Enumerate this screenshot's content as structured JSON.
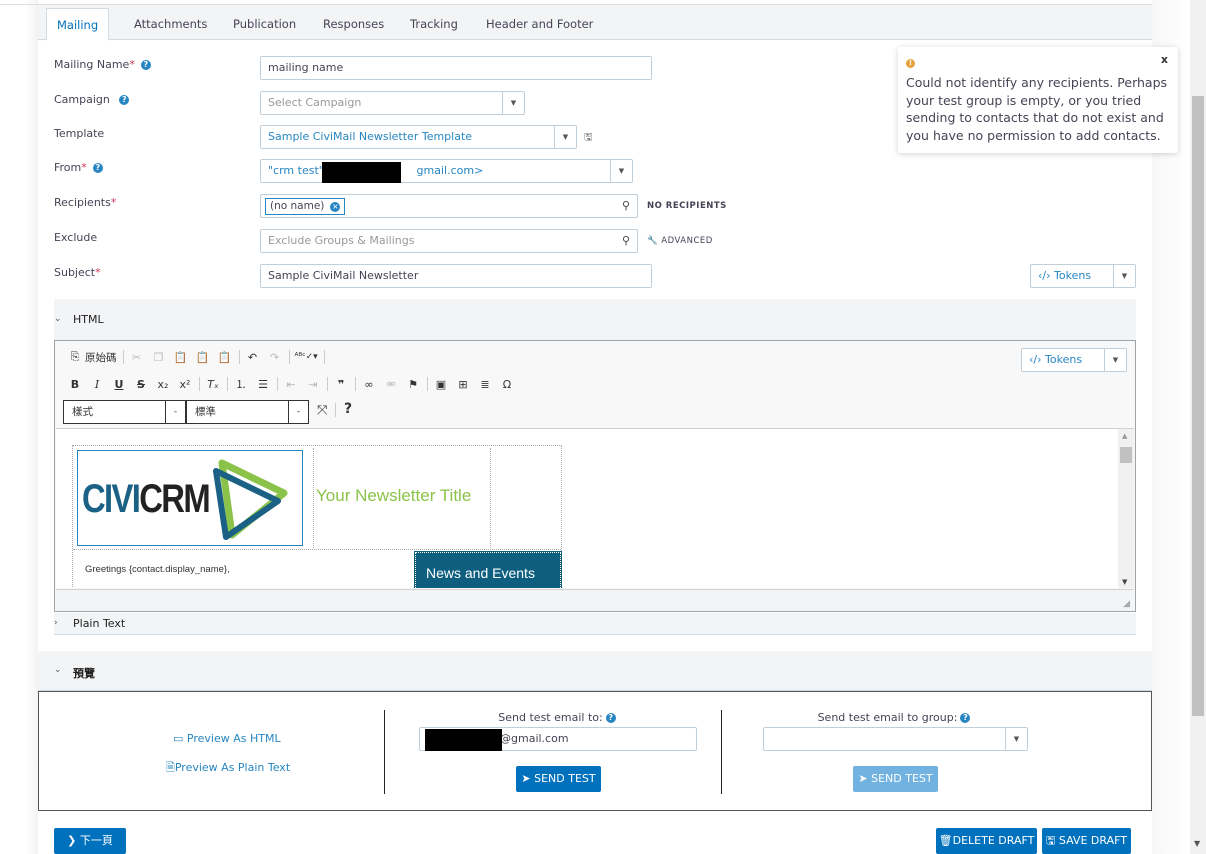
{
  "tabs": [
    {
      "label": "Mailing",
      "active": true
    },
    {
      "label": "Attachments",
      "active": false
    },
    {
      "label": "Publication",
      "active": false
    },
    {
      "label": "Responses",
      "active": false
    },
    {
      "label": "Tracking",
      "active": false
    },
    {
      "label": "Header and Footer",
      "active": false
    }
  ],
  "form": {
    "mailing_name": {
      "label": "Mailing Name",
      "value": "mailing name"
    },
    "campaign": {
      "label": "Campaign",
      "placeholder": "Select Campaign"
    },
    "template": {
      "label": "Template",
      "value": "Sample CiviMail Newsletter Template"
    },
    "from": {
      "label": "From",
      "value_prefix": "\"crm test\" <",
      "value_suffix": "gmail.com>"
    },
    "recipients": {
      "label": "Recipients",
      "chip": "(no name)",
      "status": "NO RECIPIENTS"
    },
    "exclude": {
      "label": "Exclude",
      "placeholder": "Exclude Groups & Mailings",
      "advanced": "ADVANCED"
    },
    "subject": {
      "label": "Subject",
      "value": "Sample CiviMail Newsletter"
    },
    "required_mark": "*",
    "help_mark": "?"
  },
  "tokens_label": "Tokens",
  "html_section": {
    "title": "HTML",
    "toolbar": {
      "source_label": "原始碼",
      "style_combo": "樣式",
      "format_combo": "標準",
      "help_glyph": "?"
    },
    "content": {
      "logo_civi": "CIVI",
      "logo_crm": "CRM",
      "newsletter_title": "Your Newsletter Title",
      "greeting": "Greetings {contact.display_name},",
      "news_heading": "News and Events"
    }
  },
  "plain_text_section": {
    "title": "Plain Text"
  },
  "preview_section": {
    "title": "預覽",
    "preview_html": "Preview As HTML",
    "preview_text": "Preview As Plain Text",
    "send_to_label": "Send test email to:",
    "send_to_value_suffix": "@gmail.com",
    "send_group_label": "Send test email to group:",
    "send_group_value": "",
    "send_test": "SEND TEST"
  },
  "footer": {
    "next": "下一頁",
    "delete_draft": "DELETE DRAFT",
    "save_draft": "SAVE DRAFT"
  },
  "alert": {
    "message": "Could not identify any recipients. Perhaps your test group is empty, or you tried sending to contacts that do not exist and you have no permission to add contacts.",
    "close": "x"
  },
  "colors": {
    "accent": "#0071bd",
    "link": "#2786c2",
    "required": "#cf3458",
    "warning": "#e6a23c",
    "logo_blue": "#1b6185",
    "logo_green": "#8bc34a",
    "news_bg": "#0e5f7f"
  }
}
